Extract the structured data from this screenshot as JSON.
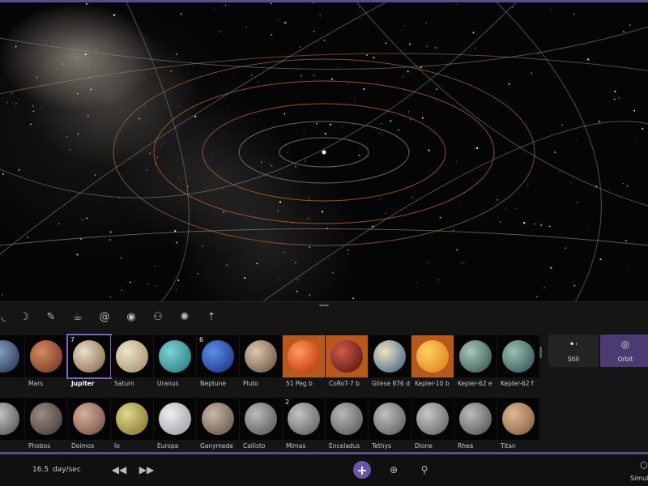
{
  "toolbar": {
    "tools": [
      {
        "name": "comet-tool-icon",
        "glyph": "◟"
      },
      {
        "name": "moon-tool-icon",
        "glyph": "☽"
      },
      {
        "name": "meteor-tool-icon",
        "glyph": "✎"
      },
      {
        "name": "teapot-tool-icon",
        "glyph": "☕"
      },
      {
        "name": "spiral-galaxy-icon",
        "glyph": "@"
      },
      {
        "name": "eye-icon",
        "glyph": "◉"
      },
      {
        "name": "group-icon",
        "glyph": "⚇"
      },
      {
        "name": "star-burst-icon",
        "glyph": "✺"
      },
      {
        "name": "upload-anchor-icon",
        "glyph": "⇡"
      }
    ]
  },
  "objects_row1": [
    {
      "label": "",
      "badge": "",
      "color1": "#8aa2c8",
      "color2": "#2c3c5c",
      "partial": true
    },
    {
      "label": "Mars",
      "badge": "",
      "color1": "#d48a62",
      "color2": "#7a3a24"
    },
    {
      "label": "Jupiter",
      "badge": "7",
      "color1": "#eadfcb",
      "color2": "#8c7052",
      "selected": true
    },
    {
      "label": "Saturn",
      "badge": "",
      "color1": "#efe4c8",
      "color2": "#a89470"
    },
    {
      "label": "Uranus",
      "badge": "",
      "color1": "#7fd3d6",
      "color2": "#2a7f86"
    },
    {
      "label": "Neptune",
      "badge": "6",
      "color1": "#5c8fe8",
      "color2": "#1b3a8c"
    },
    {
      "label": "Pluto",
      "badge": "",
      "color1": "#e0c8ae",
      "color2": "#6e5a4a"
    },
    {
      "label": "51 Peg b",
      "badge": "",
      "color1": "#ff9a5c",
      "color2": "#c23a10",
      "highlight": true
    },
    {
      "label": "CoRoT-7 b",
      "badge": "",
      "color1": "#d05a48",
      "color2": "#5c1a14",
      "highlight": true
    },
    {
      "label": "Gliese 876 d",
      "badge": "",
      "color1": "#f0e2c0",
      "color2": "#4a6c8c"
    },
    {
      "label": "Kepler-10 b",
      "badge": "",
      "color1": "#ffd060",
      "color2": "#e08420",
      "highlight": true
    },
    {
      "label": "Kepler-62 e",
      "badge": "",
      "color1": "#a8c8b8",
      "color2": "#3a5a5a"
    },
    {
      "label": "Kepler-62 f",
      "badge": "",
      "color1": "#9cc0b0",
      "color2": "#36585a"
    }
  ],
  "objects_row2": [
    {
      "label": "",
      "badge": "",
      "color1": "#c8c8c8",
      "color2": "#5a5a5a",
      "partial": true
    },
    {
      "label": "Phobos",
      "badge": "",
      "color1": "#9a8c84",
      "color2": "#4a403c"
    },
    {
      "label": "Deimos",
      "badge": "",
      "color1": "#d8b0a0",
      "color2": "#7a5448"
    },
    {
      "label": "Io",
      "badge": "",
      "color1": "#e0d890",
      "color2": "#8a7a30"
    },
    {
      "label": "Europa",
      "badge": "",
      "color1": "#f0f0f0",
      "color2": "#a0a0a8"
    },
    {
      "label": "Ganymede",
      "badge": "",
      "color1": "#c8b8a8",
      "color2": "#6a5a50"
    },
    {
      "label": "Callisto",
      "badge": "",
      "color1": "#bcbcbc",
      "color2": "#5c5c5c"
    },
    {
      "label": "Mimas",
      "badge": "2",
      "color1": "#c4c4c4",
      "color2": "#646464"
    },
    {
      "label": "Enceladus",
      "badge": "",
      "color1": "#b8b8b8",
      "color2": "#5e5e5e"
    },
    {
      "label": "Tethys",
      "badge": "",
      "color1": "#c0c0c0",
      "color2": "#626262"
    },
    {
      "label": "Dione",
      "badge": "",
      "color1": "#c8c8c8",
      "color2": "#686868"
    },
    {
      "label": "Rhea",
      "badge": "",
      "color1": "#bcbcbc",
      "color2": "#5a5a5a"
    },
    {
      "label": "Titan",
      "badge": "",
      "color1": "#e0b890",
      "color2": "#8a6448"
    }
  ],
  "modes": {
    "still_label": "Still",
    "orbit_label": "Orbit"
  },
  "bottom": {
    "speed_value": "16.5",
    "speed_unit": "day/sec",
    "sim_label": "Simul"
  },
  "colors": {
    "accent": "#5e4a8c",
    "selected_outline": "#7e62c2",
    "orbit_orange": "#b8702a",
    "orbit_grey": "#8a8a8a"
  }
}
